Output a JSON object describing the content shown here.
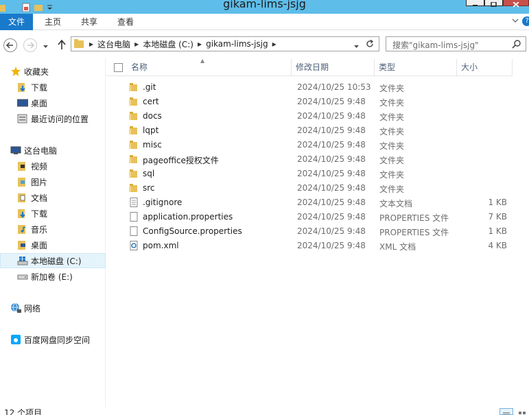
{
  "window": {
    "title": "gikam-lims-jsjg"
  },
  "ribbon": {
    "tabs": [
      {
        "label": "文件"
      },
      {
        "label": "主页"
      },
      {
        "label": "共享"
      },
      {
        "label": "查看"
      }
    ],
    "help_glyph": "?"
  },
  "address_bar": {
    "crumbs": [
      {
        "label": "这台电脑"
      },
      {
        "label": "本地磁盘 (C:)"
      },
      {
        "label": "gikam-lims-jsjg"
      }
    ]
  },
  "search": {
    "placeholder": "搜索\"gikam-lims-jsjg\""
  },
  "nav_pane": {
    "favorites": {
      "label": "收藏夹",
      "items": [
        {
          "label": "下载",
          "icon": "downloads-folder-icon"
        },
        {
          "label": "桌面",
          "icon": "desktop-icon"
        },
        {
          "label": "最近访问的位置",
          "icon": "recent-places-icon"
        }
      ]
    },
    "this_pc": {
      "label": "这台电脑",
      "items": [
        {
          "label": "视频",
          "icon": "videos-folder-icon"
        },
        {
          "label": "图片",
          "icon": "pictures-folder-icon"
        },
        {
          "label": "文档",
          "icon": "documents-folder-icon"
        },
        {
          "label": "下载",
          "icon": "downloads-folder-icon"
        },
        {
          "label": "音乐",
          "icon": "music-folder-icon"
        },
        {
          "label": "桌面",
          "icon": "desktop-folder-icon"
        },
        {
          "label": "本地磁盘 (C:)",
          "icon": "local-disk-icon",
          "selected": true
        },
        {
          "label": "新加卷 (E:)",
          "icon": "drive-icon"
        }
      ]
    },
    "network": {
      "label": "网络"
    },
    "baidu": {
      "label": "百度网盘同步空间"
    }
  },
  "file_list": {
    "columns": {
      "name": "名称",
      "date": "修改日期",
      "type": "类型",
      "size": "大小"
    },
    "rows": [
      {
        "name": ".git",
        "date": "2024/10/25 10:53",
        "type": "文件夹",
        "size": "",
        "kind": "folder"
      },
      {
        "name": "cert",
        "date": "2024/10/25 9:48",
        "type": "文件夹",
        "size": "",
        "kind": "folder"
      },
      {
        "name": "docs",
        "date": "2024/10/25 9:48",
        "type": "文件夹",
        "size": "",
        "kind": "folder"
      },
      {
        "name": "lqpt",
        "date": "2024/10/25 9:48",
        "type": "文件夹",
        "size": "",
        "kind": "folder"
      },
      {
        "name": "misc",
        "date": "2024/10/25 9:48",
        "type": "文件夹",
        "size": "",
        "kind": "folder"
      },
      {
        "name": "pageoffice授权文件",
        "date": "2024/10/25 9:48",
        "type": "文件夹",
        "size": "",
        "kind": "folder"
      },
      {
        "name": "sql",
        "date": "2024/10/25 9:48",
        "type": "文件夹",
        "size": "",
        "kind": "folder"
      },
      {
        "name": "src",
        "date": "2024/10/25 9:48",
        "type": "文件夹",
        "size": "",
        "kind": "folder"
      },
      {
        "name": ".gitignore",
        "date": "2024/10/25 9:48",
        "type": "文本文档",
        "size": "1 KB",
        "kind": "text"
      },
      {
        "name": "application.properties",
        "date": "2024/10/25 9:48",
        "type": "PROPERTIES 文件",
        "size": "7 KB",
        "kind": "file"
      },
      {
        "name": "ConfigSource.properties",
        "date": "2024/10/25 9:48",
        "type": "PROPERTIES 文件",
        "size": "1 KB",
        "kind": "file"
      },
      {
        "name": "pom.xml",
        "date": "2024/10/25 9:48",
        "type": "XML 文档",
        "size": "4 KB",
        "kind": "xml"
      }
    ]
  },
  "status_bar": {
    "item_count": "12 个项目"
  },
  "colors": {
    "titlebar": "#5ebde9",
    "file_tab": "#1979ca",
    "folder_yellow": "#e8c15a",
    "selection": "#e5f3fb"
  }
}
